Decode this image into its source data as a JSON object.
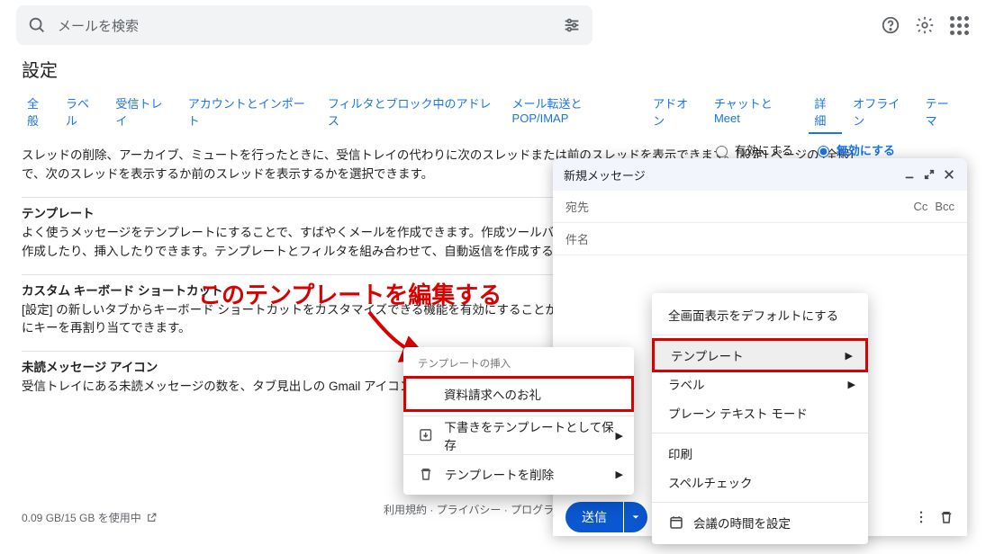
{
  "search": {
    "placeholder": "メールを検索"
  },
  "settings_title": "設定",
  "tabs": {
    "general": "全般",
    "labels": "ラベル",
    "inbox": "受信トレイ",
    "accounts": "アカウントとインポート",
    "filters": "フィルタとブロック中のアドレス",
    "pop": "メール転送と POP/IMAP",
    "addons": "アドオン",
    "chat": "チャットと Meet",
    "advanced": "詳細",
    "offline": "オフライン",
    "theme": "テーマ"
  },
  "row1": "スレッドの削除、アーカイブ、ミュートを行ったときに、受信トレイの代わりに次のスレッドまたは前のスレッドを表示できます。[設定] ページの [全般] で、次のスレッドを表示するか前のスレッドを表示するかを選択できます。",
  "row2": {
    "title": "テンプレート",
    "body": "よく使うメッセージをテンプレートにすることで、すばやくメールを作成できます。作成ツールバーの [その他のオプション] メニューで、テンプレートを作成したり、挿入したりできます。テンプレートとフィルタを組み合わせて、自動返信を作成することもできます。"
  },
  "row3": {
    "title": "カスタム キーボード ショートカット",
    "body": "[設定] の新しいタブからキーボード ショートカットをカスタマイズできる機能を有効にすることができます。この新しい [設定] タブでは、さまざまな操作にキーを再割り当てできます。"
  },
  "row4": {
    "title": "未読メッセージ アイコン",
    "body": "受信トレイにある未読メッセージの数を、タブ見出しの Gmail アイコンで確認できます。"
  },
  "radio": {
    "enable": "有効にする",
    "disable": "無効にする"
  },
  "bottom_links": "利用規約 · プライバシー · プログラム ポリシー",
  "storage": "0.09 GB/15 GB を使用中",
  "annotation": "このテンプレートを編集する",
  "compose": {
    "title": "新規メッセージ",
    "to": "宛先",
    "cc": "Cc",
    "bcc": "Bcc",
    "subject": "件名",
    "send": "送信"
  },
  "options_menu": {
    "fullscreen": "全画面表示をデフォルトにする",
    "template": "テンプレート",
    "label": "ラベル",
    "plain": "プレーン テキスト モード",
    "print": "印刷",
    "spell": "スペルチェック",
    "meeting": "会議の時間を設定"
  },
  "tpl_menu": {
    "header": "テンプレートの挿入",
    "item1": "資料請求へのお礼",
    "save": "下書きをテンプレートとして保存",
    "delete": "テンプレートを削除"
  }
}
